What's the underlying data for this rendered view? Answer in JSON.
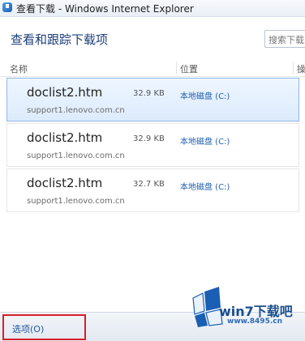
{
  "window": {
    "title": "查看下载 - Windows Internet Explorer"
  },
  "header": {
    "title": "查看和跟踪下载项",
    "search_placeholder": "搜索下载"
  },
  "columns": {
    "name": "名称",
    "location": "位置",
    "actions": "操"
  },
  "downloads": [
    {
      "filename": "doclist2.htm",
      "size": "32.9 KB",
      "location": "本地磁盘 (C:)",
      "source": "support1.lenovo.com.cn",
      "selected": true
    },
    {
      "filename": "doclist2.htm",
      "size": "32.9 KB",
      "location": "本地磁盘 (C:)",
      "source": "support1.lenovo.com.cn",
      "selected": false
    },
    {
      "filename": "doclist2.htm",
      "size": "32.7 KB",
      "location": "本地磁盘 (C:)",
      "source": "support1.lenovo.com.cn",
      "selected": false
    }
  ],
  "footer": {
    "options_label": "选项(O)"
  },
  "watermark": {
    "text": "win7下载吧",
    "url": "www.8495.cn"
  },
  "colors": {
    "title_blue": "#1d3f7a",
    "location_link": "#2060b0",
    "highlight_border": "#d6202a",
    "selected_row": "#dcebfc"
  }
}
